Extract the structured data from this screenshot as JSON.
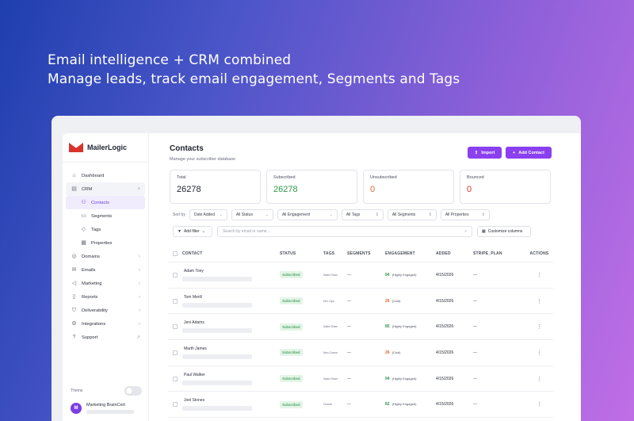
{
  "hero": {
    "line1": "Email intelligence + CRM combined",
    "line2": "Manage leads, track email engagement, Segments and Tags"
  },
  "brand": {
    "name": "MailerLogic",
    "accent": "#8a3ff0"
  },
  "sidebar": {
    "items": [
      {
        "label": "Dashboard",
        "icon": "home-icon"
      },
      {
        "label": "CRM",
        "icon": "crm-icon",
        "expanded": true
      },
      {
        "label": "Contacts",
        "icon": "users-icon",
        "active": true
      },
      {
        "label": "Segments",
        "icon": "folder-icon"
      },
      {
        "label": "Tags",
        "icon": "tag-icon"
      },
      {
        "label": "Properties",
        "icon": "grid-icon"
      },
      {
        "label": "Domains",
        "icon": "globe-icon"
      },
      {
        "label": "Emails",
        "icon": "mail-icon"
      },
      {
        "label": "Marketing",
        "icon": "megaphone-icon"
      },
      {
        "label": "Reports",
        "icon": "report-icon"
      },
      {
        "label": "Deliverability",
        "icon": "shield-icon"
      },
      {
        "label": "Integrations",
        "icon": "plug-icon"
      },
      {
        "label": "Support",
        "icon": "help-icon"
      }
    ],
    "theme_label": "Theme",
    "user": {
      "initial": "M",
      "name": "Marketing BrainCert"
    }
  },
  "main": {
    "title": "Contacts",
    "subtitle": "Manage your subscriber database",
    "import_label": "Import",
    "add_label": "Add Contact",
    "stats": [
      {
        "label": "Total",
        "value": "26278"
      },
      {
        "label": "Subscribed",
        "value": "26278"
      },
      {
        "label": "Unsubscribed",
        "value": "0"
      },
      {
        "label": "Bounced",
        "value": "0"
      }
    ],
    "sort_label": "Sort by",
    "filters": [
      "Date Added",
      "All Status",
      "All Engagement",
      "All Tags",
      "All Segments",
      "All Properties"
    ],
    "add_filter_label": "Add filter",
    "search_placeholder": "Search by email or name...",
    "customize_label": "Customize columns",
    "columns": [
      "CONTACT",
      "STATUS",
      "TAGS",
      "SEGMENTS",
      "ENGAGEMENT",
      "ADDED",
      "STRIPE_PLAN",
      "ACTIONS"
    ],
    "rows": [
      {
        "name": "Adam Tony",
        "status": "Subscribed",
        "tag": "Sales Team",
        "segments": "—",
        "score": "94",
        "level": "(Highly Engaged)",
        "added": "4/15/2026",
        "plan": "—"
      },
      {
        "name": "Tom Merill",
        "status": "Subscribed",
        "tag": "Dev Ops",
        "segments": "—",
        "score": "26",
        "level": "(Cold)",
        "added": "4/15/2026",
        "plan": "—"
      },
      {
        "name": "Jeni Adams",
        "status": "Subscribed",
        "tag": "Sales Team",
        "segments": "—",
        "score": "85",
        "level": "(Highly Engaged)",
        "added": "4/15/2026",
        "plan": "—"
      },
      {
        "name": "Marth James",
        "status": "Subscribed",
        "tag": "Non-Comm",
        "segments": "—",
        "score": "26",
        "level": "(Cold)",
        "added": "4/15/2026",
        "plan": "—"
      },
      {
        "name": "Paul Walker",
        "status": "Subscribed",
        "tag": "Sales Team",
        "segments": "—",
        "score": "94",
        "level": "(Highly Engaged)",
        "added": "4/15/2026",
        "plan": "—"
      },
      {
        "name": "Joel Stones",
        "status": "Subscribed",
        "tag": "Clouds",
        "segments": "—",
        "score": "82",
        "level": "(Highly Engaged)",
        "added": "4/15/2026",
        "plan": "—"
      }
    ]
  }
}
